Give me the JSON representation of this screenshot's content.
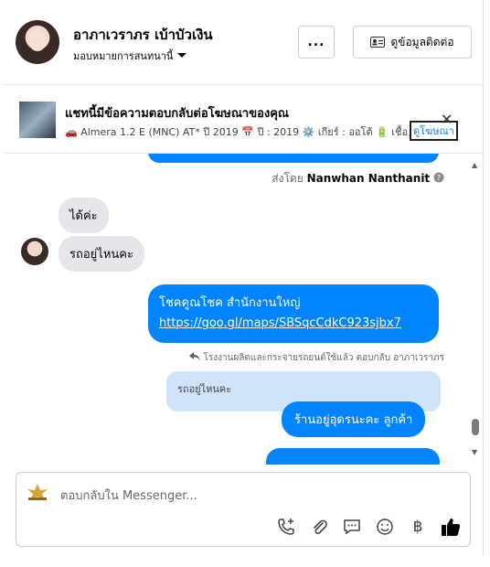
{
  "header": {
    "name": "อาภาเวราภร เบ้าบัวเงิน",
    "assign_label": "มอบหมายการสนทนานี้",
    "more_label": "...",
    "contact_label": "ดูข้อมูลติดต่อ"
  },
  "ad": {
    "title": "แชทนี้มีข้อความตอบกลับต่อโฆษณาของคุณ",
    "detail": "🚗 Almera 1.2 E (MNC) AT* ปี 2019 📅 ปี : 2019 ⚙️ เกียร์ : ออโต้ 🔋 เชื้อเพลิง",
    "link_label": "ดูโฆษณา",
    "close_label": "✕"
  },
  "chat": {
    "sent_by_prefix": "ส่งโดย",
    "sent_by_name": "Nanwhan Nanthanit",
    "incoming": [
      "ได้ค่ะ",
      "รถอยู่ไหนคะ"
    ],
    "outgoing_line1": "โชคคูณโชค สำนักงานใหญ่",
    "outgoing_link": "https://goo.gl/maps/SBSqcCdkC923sjbx7",
    "reply_meta": "โรงงานผลิตและกระจายรถยนต์ใช้แล้ว ตอบกลับ อาภาเวราภร",
    "quoted_text": "รถอยู่ไหนคะ",
    "reply_text": "ร้านอยู่อุดรนะคะ  ลูกค้า"
  },
  "composer": {
    "placeholder": "ตอบกลับใน Messenger..."
  },
  "colors": {
    "messenger_blue": "#0084ff",
    "bubble_gray": "#e4e6eb",
    "quoted_bg": "#cfe3fb"
  },
  "icons": [
    "chevron-down-icon",
    "contact-card-icon",
    "close-icon",
    "help-icon",
    "call-add-icon",
    "attach-icon",
    "chat-icon",
    "emoji-icon",
    "baht-icon",
    "like-icon"
  ]
}
